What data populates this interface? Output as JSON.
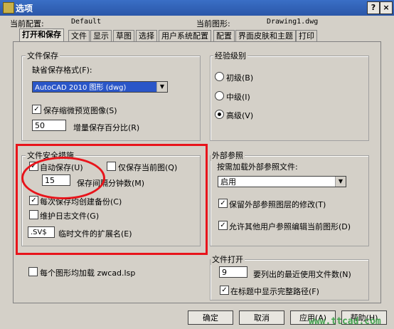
{
  "window": {
    "title": "选项",
    "help": "?",
    "close": "×"
  },
  "profile": {
    "label": "当前配置:",
    "value": "Default"
  },
  "drawing": {
    "label": "当前图形:",
    "value": "Drawing1.dwg"
  },
  "tabs": [
    "打开和保存",
    "文件",
    "显示",
    "草图",
    "选择",
    "用户系统配置",
    "配置",
    "界面皮肤和主题",
    "打印"
  ],
  "file_save": {
    "title": "文件保存",
    "format_label": "缺省保存格式(F):",
    "format_value": "AutoCAD 2010 图形 (dwg)",
    "thumbnail": {
      "label": "保存缩微预览图像(S)",
      "checked": true
    },
    "incremental": {
      "value": "50",
      "label": "增量保存百分比(R)"
    }
  },
  "experience": {
    "title": "经验级别",
    "options": [
      {
        "label": "初级(B)",
        "selected": false
      },
      {
        "label": "中级(I)",
        "selected": false
      },
      {
        "label": "高级(V)",
        "selected": true
      }
    ]
  },
  "file_safety": {
    "title": "文件安全措施",
    "autosave": {
      "label": "自动保存(U)",
      "checked": true
    },
    "save_current": {
      "label": "仅保存当前图(Q)",
      "checked": false
    },
    "interval": {
      "value": "15",
      "label": "保存间隔分钟数(M)"
    },
    "backup": {
      "label": "每次保存均创建备份(C)",
      "checked": true
    },
    "log": {
      "label": "维护日志文件(G)",
      "checked": false
    },
    "temp_ext": {
      "value": ".SV$",
      "label": "临时文件的扩展名(E)"
    }
  },
  "xref": {
    "title": "外部参照",
    "load_label": "按需加载外部参照文件:",
    "load_value": "启用",
    "retain": {
      "label": "保留外部参照图层的修改(T)",
      "checked": true
    },
    "allow_edit": {
      "label": "允许其他用户参照编辑当前图形(D)",
      "checked": true
    }
  },
  "lsp": {
    "label": "每个图形均加载 zwcad.lsp",
    "checked": false
  },
  "file_open": {
    "title": "文件打开",
    "recent": {
      "value": "9",
      "label": "要列出的最近使用文件数(N)"
    },
    "fullpath": {
      "label": "在标题中显示完整路径(F)",
      "checked": true
    }
  },
  "buttons": {
    "ok": "确定",
    "cancel": "取消",
    "apply": "应用(A)",
    "help": "帮助(H)"
  },
  "watermark": "www.ttcad.com"
}
